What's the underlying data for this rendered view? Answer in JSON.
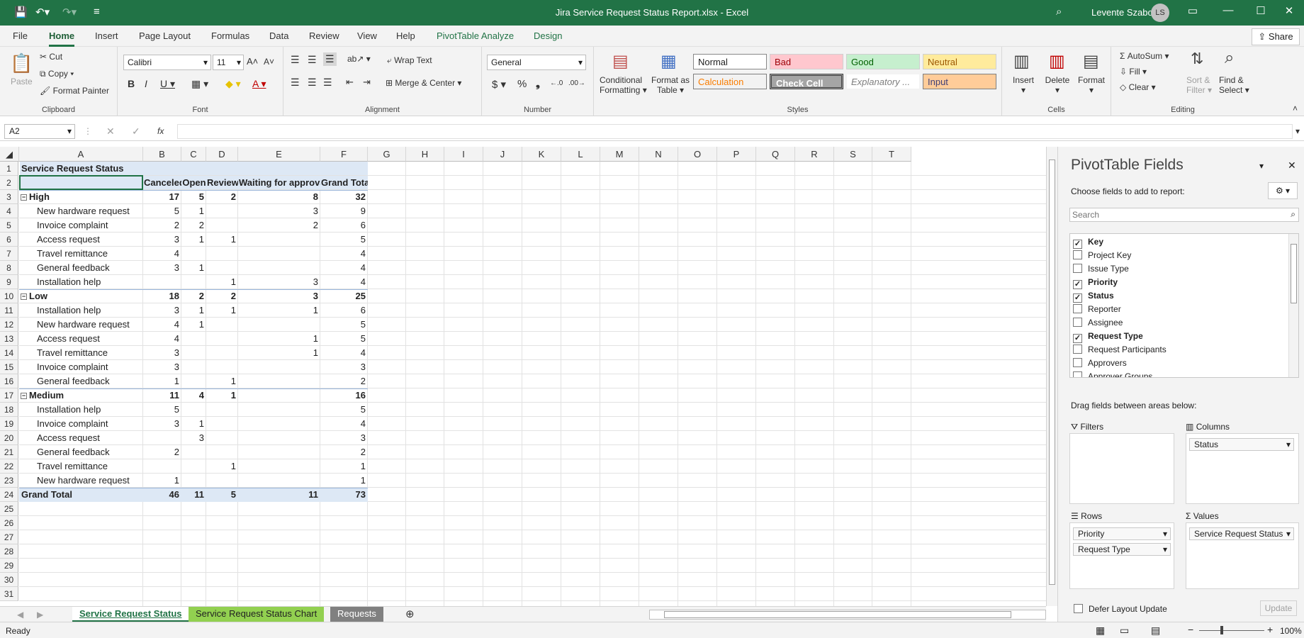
{
  "titlebar": {
    "title": "Jira Service Request Status Report.xlsx  -  Excel",
    "user": "Levente Szabo",
    "initials": "LS"
  },
  "menu": {
    "tabs": [
      "File",
      "Home",
      "Insert",
      "Page Layout",
      "Formulas",
      "Data",
      "Review",
      "View",
      "Help",
      "PivotTable Analyze",
      "Design"
    ],
    "share": "Share"
  },
  "ribbon": {
    "clipboard": {
      "paste": "Paste",
      "cut": "Cut",
      "copy": "Copy",
      "format_painter": "Format Painter",
      "label": "Clipboard"
    },
    "font": {
      "name": "Calibri",
      "size": "11",
      "label": "Font"
    },
    "alignment": {
      "wrap": "Wrap Text",
      "merge": "Merge & Center",
      "label": "Alignment"
    },
    "number": {
      "format": "General",
      "label": "Number"
    },
    "styles": {
      "cond": "Conditional",
      "cond2": "Formatting",
      "fmt": "Format as",
      "fmt2": "Table",
      "normal": "Normal",
      "bad": "Bad",
      "good": "Good",
      "neutral": "Neutral",
      "calculation": "Calculation",
      "check": "Check Cell",
      "explanatory": "Explanatory ...",
      "input": "Input",
      "label": "Styles"
    },
    "cells": {
      "insert": "Insert",
      "delete": "Delete",
      "format": "Format",
      "label": "Cells"
    },
    "editing": {
      "autosum": "AutoSum",
      "fill": "Fill",
      "clear": "Clear",
      "sort": "Sort &",
      "sort2": "Filter",
      "find": "Find &",
      "find2": "Select",
      "label": "Editing"
    }
  },
  "formula_bar": {
    "name_box": "A2",
    "fx": "fx",
    "value": ""
  },
  "columns": [
    "A",
    "B",
    "C",
    "D",
    "E",
    "F",
    "G",
    "H",
    "I",
    "J",
    "K",
    "L",
    "M",
    "N",
    "O",
    "P",
    "Q",
    "R",
    "S",
    "T"
  ],
  "pivot": {
    "title": "Service Request Status",
    "headers": [
      "Canceled",
      "Open",
      "Review",
      "Waiting for approval",
      "Grand Total"
    ],
    "rows": [
      {
        "label": "High",
        "group": true,
        "v": [
          "17",
          "5",
          "2",
          "8",
          "32"
        ]
      },
      {
        "label": "New hardware request",
        "v": [
          "5",
          "1",
          "",
          "3",
          "9"
        ]
      },
      {
        "label": "Invoice complaint",
        "v": [
          "2",
          "2",
          "",
          "2",
          "6"
        ]
      },
      {
        "label": "Access request",
        "v": [
          "3",
          "1",
          "1",
          "",
          "5"
        ]
      },
      {
        "label": "Travel remittance",
        "v": [
          "4",
          "",
          "",
          "",
          "4"
        ]
      },
      {
        "label": "General feedback",
        "v": [
          "3",
          "1",
          "",
          "",
          "4"
        ]
      },
      {
        "label": "Installation help",
        "v": [
          "",
          "",
          "1",
          "3",
          "4"
        ]
      },
      {
        "label": "Low",
        "group": true,
        "v": [
          "18",
          "2",
          "2",
          "3",
          "25"
        ]
      },
      {
        "label": "Installation help",
        "v": [
          "3",
          "1",
          "1",
          "1",
          "6"
        ]
      },
      {
        "label": "New hardware request",
        "v": [
          "4",
          "1",
          "",
          "",
          "5"
        ]
      },
      {
        "label": "Access request",
        "v": [
          "4",
          "",
          "",
          "1",
          "5"
        ]
      },
      {
        "label": "Travel remittance",
        "v": [
          "3",
          "",
          "",
          "1",
          "4"
        ]
      },
      {
        "label": "Invoice complaint",
        "v": [
          "3",
          "",
          "",
          "",
          "3"
        ]
      },
      {
        "label": "General feedback",
        "v": [
          "1",
          "",
          "1",
          "",
          "2"
        ]
      },
      {
        "label": "Medium",
        "group": true,
        "v": [
          "11",
          "4",
          "1",
          "",
          "16"
        ]
      },
      {
        "label": "Installation help",
        "v": [
          "5",
          "",
          "",
          "",
          "5"
        ]
      },
      {
        "label": "Invoice complaint",
        "v": [
          "3",
          "1",
          "",
          "",
          "4"
        ]
      },
      {
        "label": "Access request",
        "v": [
          "",
          "3",
          "",
          "",
          "3"
        ]
      },
      {
        "label": "General feedback",
        "v": [
          "2",
          "",
          "",
          "",
          "2"
        ]
      },
      {
        "label": "Travel remittance",
        "v": [
          "",
          "",
          "1",
          "",
          "1"
        ]
      },
      {
        "label": "New hardware request",
        "v": [
          "1",
          "",
          "",
          "",
          "1"
        ]
      }
    ],
    "grand_total": {
      "label": "Grand Total",
      "v": [
        "46",
        "11",
        "5",
        "11",
        "73"
      ]
    }
  },
  "sheets": [
    "Service Request Status",
    "Service Request Status Chart",
    "Requests"
  ],
  "status": {
    "ready": "Ready",
    "zoom": "100%"
  },
  "panel": {
    "title": "PivotTable Fields",
    "choose": "Choose fields to add to report:",
    "search_placeholder": "Search",
    "fields": [
      {
        "name": "Key",
        "checked": true
      },
      {
        "name": "Project Key",
        "checked": false
      },
      {
        "name": "Issue Type",
        "checked": false
      },
      {
        "name": "Priority",
        "checked": true
      },
      {
        "name": "Status",
        "checked": true
      },
      {
        "name": "Reporter",
        "checked": false
      },
      {
        "name": "Assignee",
        "checked": false
      },
      {
        "name": "Request Type",
        "checked": true
      },
      {
        "name": "Request Participants",
        "checked": false
      },
      {
        "name": "Approvers",
        "checked": false
      },
      {
        "name": "Approver Groups",
        "checked": false
      }
    ],
    "drag": "Drag fields between areas below:",
    "filters": "Filters",
    "columns": "Columns",
    "rows": "Rows",
    "values": "Values",
    "col_items": [
      "Status"
    ],
    "row_items": [
      "Priority",
      "Request Type"
    ],
    "val_items": [
      "Service Request Status"
    ],
    "defer": "Defer Layout Update",
    "update": "Update"
  }
}
